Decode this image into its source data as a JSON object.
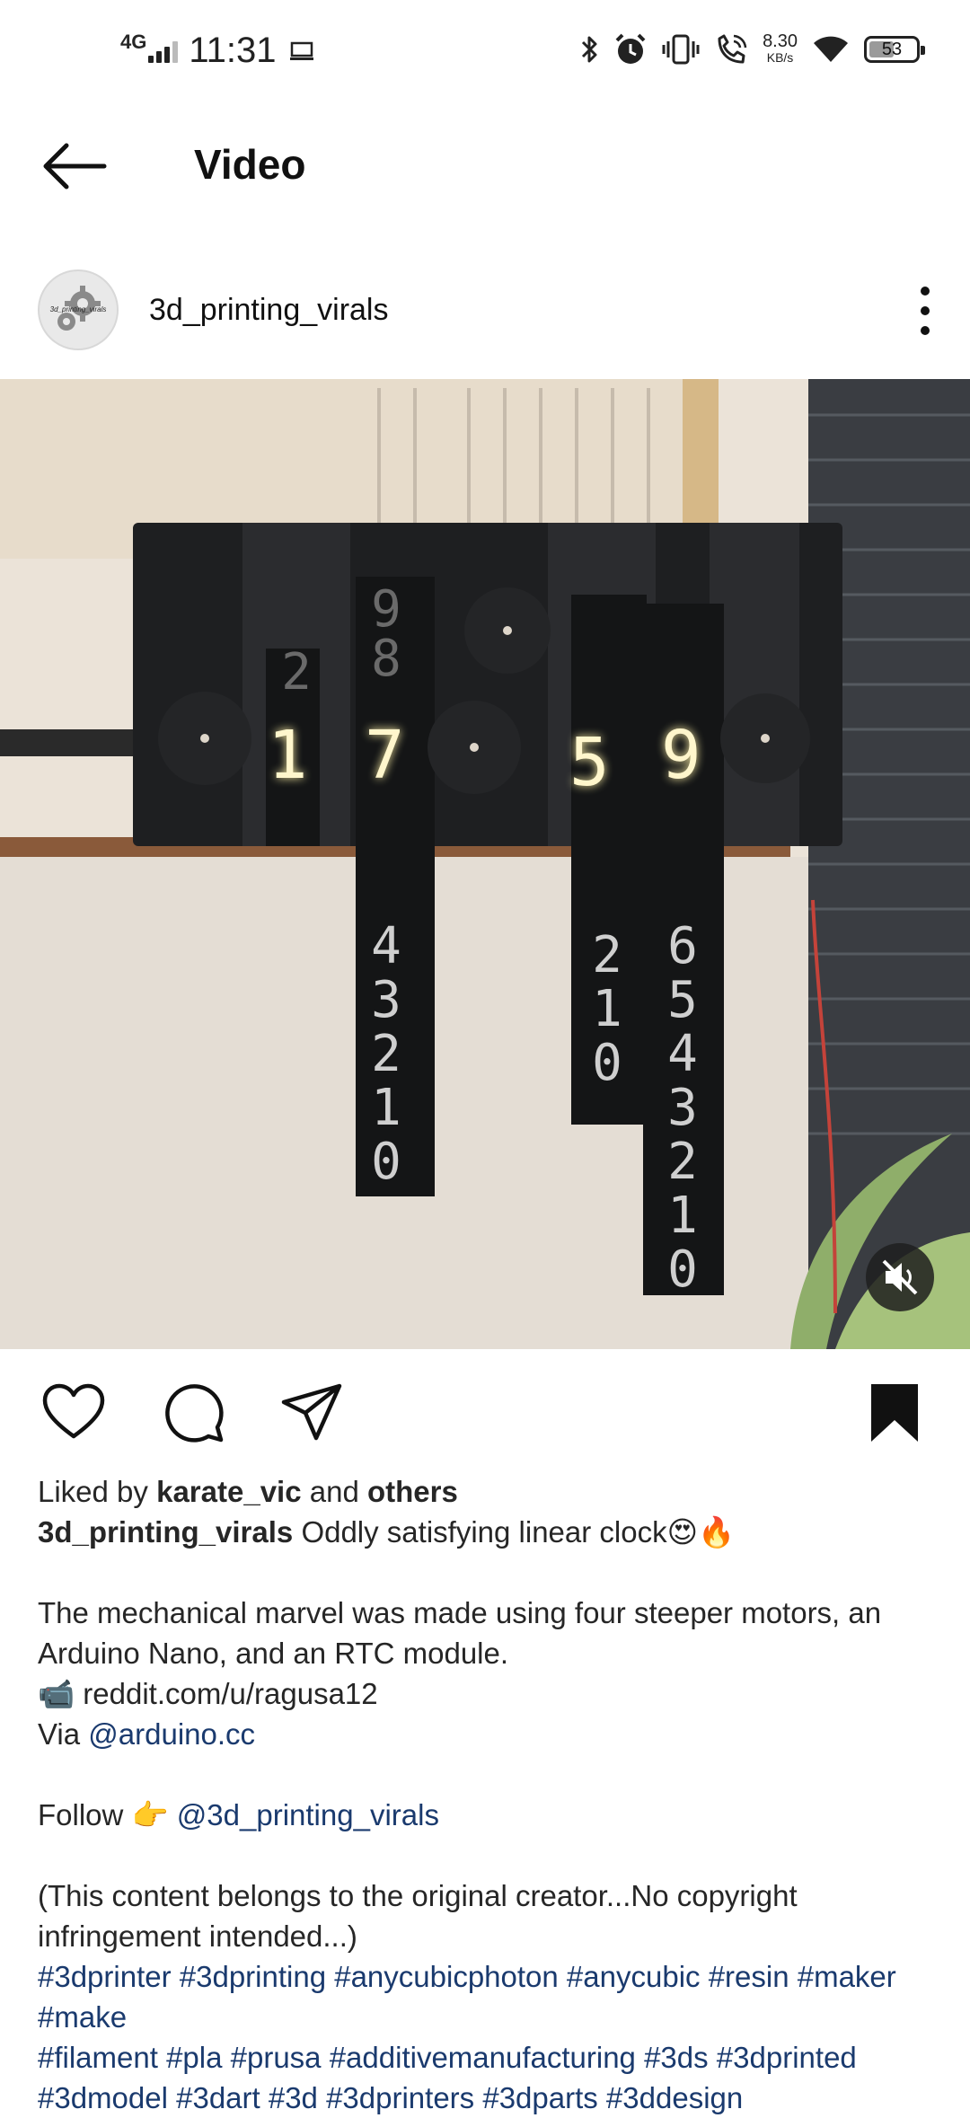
{
  "status_bar": {
    "network": "4G",
    "time": "11:31",
    "speed_value": "8.30",
    "speed_unit": "KB/s",
    "battery": "53",
    "battery_level": 0.53
  },
  "header": {
    "title": "Video"
  },
  "post": {
    "username": "3d_printing_virals",
    "avatar_text": "3d_printing_virals"
  },
  "video": {
    "clock_digits": [
      "1",
      "7",
      "5",
      "9"
    ],
    "muted": true
  },
  "likes": {
    "prefix": "Liked by",
    "user": "karate_vic",
    "conj": "and",
    "others": "others"
  },
  "caption": {
    "author": "3d_printing_virals",
    "headline": "Oddly satisfying linear clock😍🔥",
    "body": "The mechanical marvel was made using four steeper motors, an Arduino Nano, and an RTC module.",
    "camera_emoji": "📹",
    "credit_link": "reddit.com/u/ragusa12",
    "via_label": "Via",
    "via_link": "@arduino.cc",
    "follow_label": "Follow 👉",
    "follow_link": "@3d_printing_virals",
    "disclaimer": "(This content belongs to the original creator...No copyright infringement intended...)",
    "hashtags_line1": "#3dprinter #3dprinting #anycubicphoton #anycubic #resin #maker #make",
    "hashtags_line2": "#filament #pla #prusa #additivemanufacturing #3ds #3dprinted",
    "hashtags_line3": "#3dmodel #3dart #3d #3dprinters #3dparts #3ddesign"
  }
}
